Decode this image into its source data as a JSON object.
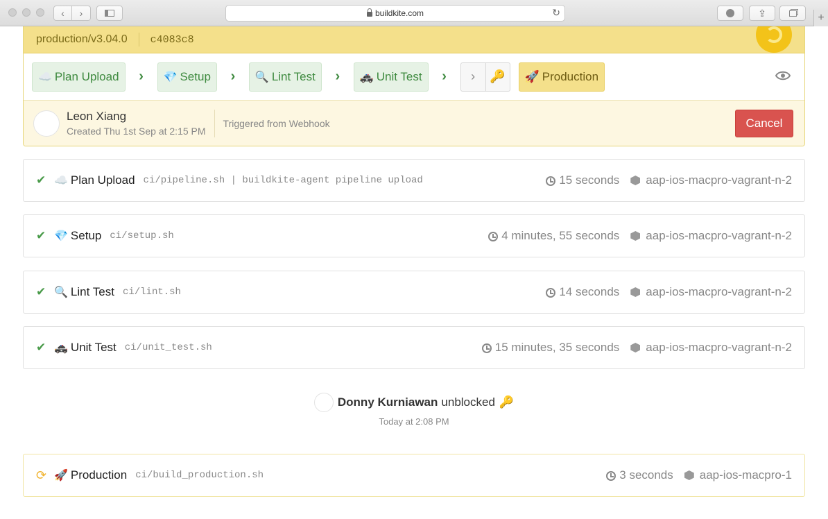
{
  "browser": {
    "url": "buildkite.com"
  },
  "build": {
    "branch": "production/v3.04.0",
    "commit": "c4083c8",
    "status_color": "#f3c319",
    "pipeline_steps": [
      {
        "emoji": "☁️",
        "label": "Plan Upload",
        "state": "passed"
      },
      {
        "emoji": "💎",
        "label": "Setup",
        "state": "passed"
      },
      {
        "emoji": "🔍",
        "label": "Lint Test",
        "state": "passed"
      },
      {
        "emoji": "🚓",
        "label": "Unit Test",
        "state": "passed"
      }
    ],
    "block_step": {
      "emoji": "🔑",
      "state": "unblocked"
    },
    "production_step": {
      "emoji": "🚀",
      "label": "Production",
      "state": "running"
    },
    "creator": "Leon Xiang",
    "created": "Created Thu 1st Sep at 2:15 PM",
    "trigger": "Triggered from Webhook",
    "cancel_label": "Cancel"
  },
  "jobs": [
    {
      "emoji": "☁️",
      "label": "Plan Upload",
      "command": "ci/pipeline.sh | buildkite-agent pipeline upload",
      "duration": "15 seconds",
      "agent": "aap-ios-macpro-vagrant-n-2",
      "state": "passed"
    },
    {
      "emoji": "💎",
      "label": "Setup",
      "command": "ci/setup.sh",
      "duration": "4 minutes, 55 seconds",
      "agent": "aap-ios-macpro-vagrant-n-2",
      "state": "passed"
    },
    {
      "emoji": "🔍",
      "label": "Lint Test",
      "command": "ci/lint.sh",
      "duration": "14 seconds",
      "agent": "aap-ios-macpro-vagrant-n-2",
      "state": "passed"
    },
    {
      "emoji": "🚓",
      "label": "Unit Test",
      "command": "ci/unit_test.sh",
      "duration": "15 minutes, 35 seconds",
      "agent": "aap-ios-macpro-vagrant-n-2",
      "state": "passed"
    }
  ],
  "unblock": {
    "user": "Donny Kurniawan",
    "action": "unblocked",
    "emoji": "🔑",
    "time": "Today at 2:08 PM"
  },
  "production_job": {
    "emoji": "🚀",
    "label": "Production",
    "command": "ci/build_production.sh",
    "duration": "3 seconds",
    "agent": "aap-ios-macpro-1",
    "state": "running"
  },
  "colors": {
    "passed": "#3e8a3f",
    "running": "#f3c319",
    "cancel": "#d9534f"
  }
}
